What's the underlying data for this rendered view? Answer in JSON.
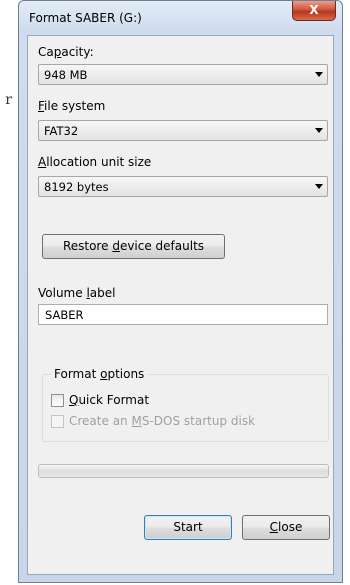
{
  "background": {
    "text": "r"
  },
  "window": {
    "title": "Format SABER (G:)",
    "close_glyph": "X"
  },
  "capacity": {
    "label_pre": "Ca",
    "label_key": "p",
    "label_post": "acity:",
    "value": "948 MB"
  },
  "file_system": {
    "label_key": "F",
    "label_post": "ile system",
    "value": "FAT32"
  },
  "allocation": {
    "label_key": "A",
    "label_post": "llocation unit size",
    "value": "8192 bytes"
  },
  "restore_button": {
    "label_pre": "Restore ",
    "label_key": "d",
    "label_post": "evice defaults"
  },
  "volume_label": {
    "label_pre": "Volume ",
    "label_key": "l",
    "label_post": "abel",
    "value": "SABER"
  },
  "format_options": {
    "label_pre": "Format ",
    "label_key": "o",
    "label_post": "ptions",
    "quick_format": {
      "label_key": "Q",
      "label_post": "uick Format",
      "checked": false
    },
    "msdos": {
      "label_pre": "Create an ",
      "label_key": "M",
      "label_post": "S-DOS startup disk",
      "checked": false,
      "enabled": false
    }
  },
  "progress": {
    "value": 0
  },
  "buttons": {
    "start": "Start",
    "close_key": "C",
    "close_post": "lose"
  },
  "colors": {
    "title_bar": "#cfdced",
    "close_button": "#c8452b",
    "dialog_face": "#f0f0f0",
    "default_button_border": "#3c7fb1"
  }
}
